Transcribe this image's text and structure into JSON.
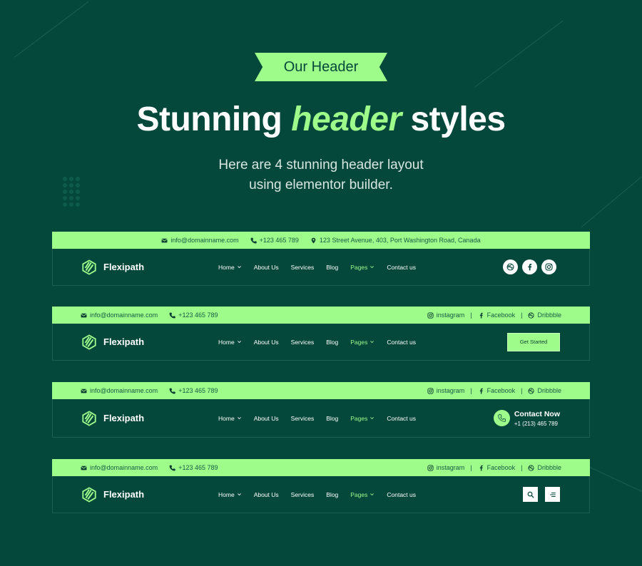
{
  "ribbon_label": "Our Header",
  "title": {
    "part1": "Stunning ",
    "accent": "header",
    "part2": " styles"
  },
  "subtitle": {
    "line1": "Here are 4 stunning header layout",
    "line2": "using elementor builder."
  },
  "brand": {
    "name": "Flexipath",
    "accent_color": "#9efd8a",
    "bg_color": "#04473b"
  },
  "contact": {
    "email": "info@domainname.com",
    "phone": "+123 465 789",
    "address": "123 Street Avenue, 403, Port Washington Road, Canada"
  },
  "social_links": {
    "instagram": "instagram",
    "facebook": "Facebook",
    "dribbble": "Dribbble"
  },
  "nav": [
    {
      "label": "Home",
      "dropdown": true,
      "active": false
    },
    {
      "label": "About Us",
      "dropdown": false,
      "active": false
    },
    {
      "label": "Services",
      "dropdown": false,
      "active": false
    },
    {
      "label": "Blog",
      "dropdown": false,
      "active": false
    },
    {
      "label": "Pages",
      "dropdown": true,
      "active": true
    },
    {
      "label": "Contact us",
      "dropdown": false,
      "active": false
    }
  ],
  "header2": {
    "cta_label": "Get Started"
  },
  "header3": {
    "contact_title": "Contact Now",
    "contact_phone": "+1 (213) 465 789"
  },
  "header1": {
    "social_icons": [
      "dribbble-icon",
      "facebook-icon",
      "instagram-icon"
    ]
  },
  "header4": {
    "buttons": [
      "search-icon",
      "menu-icon"
    ]
  }
}
